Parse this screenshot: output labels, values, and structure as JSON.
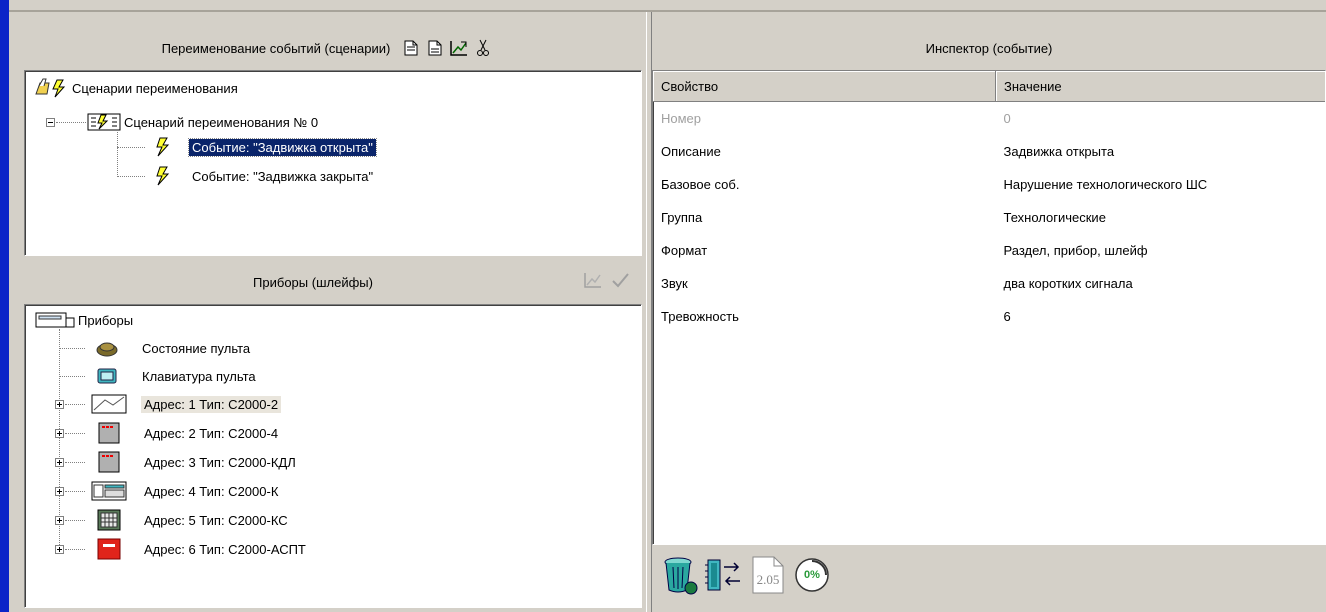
{
  "scenarios": {
    "header": "Переименование событий (сценарии)",
    "tree": {
      "root": "Сценарии переименования",
      "scenario": "Сценарий переименования № 0",
      "events": [
        "Событие: \"Задвижка открыта\"",
        "Событие: \"Задвижка закрыта\""
      ]
    }
  },
  "devices": {
    "header": "Приборы (шлейфы)",
    "tree": {
      "root": "Приборы",
      "items": [
        "Состояние пульта",
        "Клавиатура пульта",
        "Адрес: 1 Тип: С2000-2",
        "Адрес: 2 Тип: С2000-4",
        "Адрес: 3 Тип: С2000-КДЛ",
        "Адрес: 4 Тип: С2000-К",
        "Адрес: 5 Тип: С2000-КС",
        "Адрес: 6 Тип: С2000-АСПТ"
      ]
    }
  },
  "inspector": {
    "header": "Инспектор (событие)",
    "columns": [
      "Свойство",
      "Значение"
    ],
    "rows": [
      [
        "Номер",
        "0"
      ],
      [
        "Описание",
        "Задвижка открыта"
      ],
      [
        "Базовое соб.",
        "Нарушение технологического ШС"
      ],
      [
        "Группа",
        "Технологические"
      ],
      [
        "Формат",
        "Раздел, прибор, шлейф"
      ],
      [
        "Звук",
        "два коротких сигнала"
      ],
      [
        "Тревожность",
        "6"
      ]
    ]
  },
  "footer": {
    "version_icon_text": "2.05",
    "percent_icon_text": "0%"
  },
  "icons": [
    "new-document-icon",
    "copy-document-icon",
    "edit-bind-icon",
    "cut-icon",
    "bind-icon",
    "apply-check-icon",
    "trash-icon",
    "chip-transfer-icon",
    "version-icon",
    "progress-percent-icon"
  ]
}
